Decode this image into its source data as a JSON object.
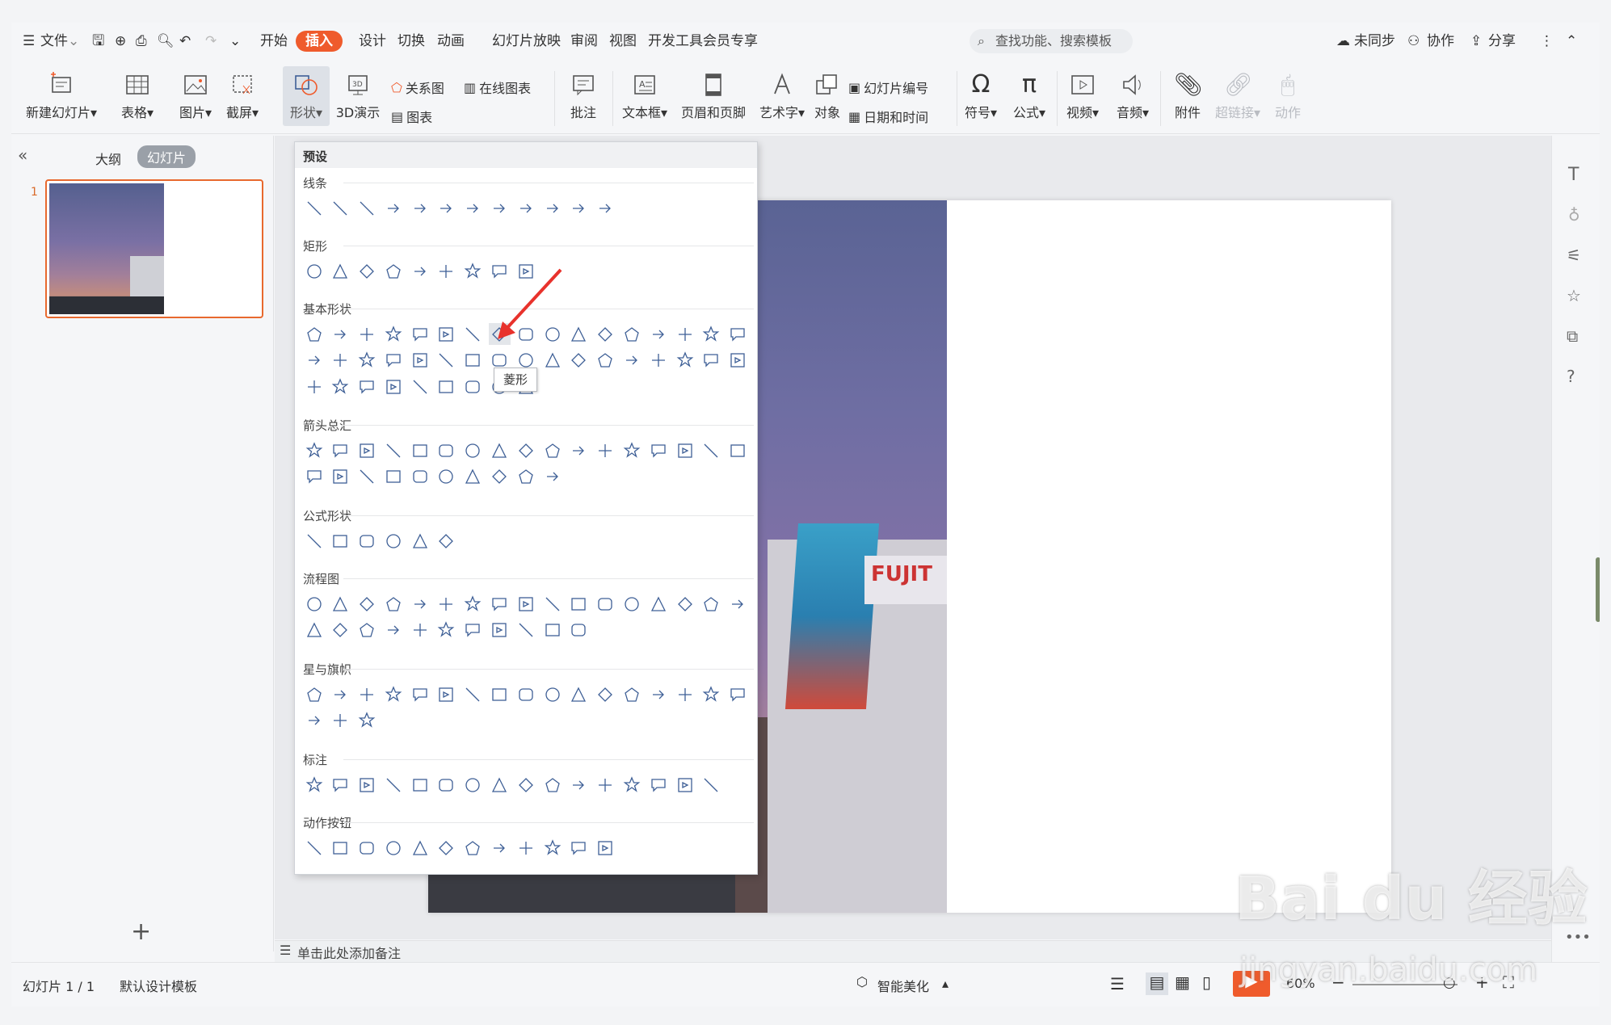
{
  "menubar": {
    "file": "文件",
    "tabs": [
      "开始",
      "插入",
      "设计",
      "切换",
      "动画",
      "幻灯片放映",
      "审阅",
      "视图",
      "开发工具",
      "会员专享"
    ],
    "search_placeholder": "查找功能、搜索模板",
    "sync": "未同步",
    "collab": "协作",
    "share": "分享"
  },
  "ribbon": {
    "new_slide": "新建幻灯片",
    "table": "表格",
    "picture": "图片",
    "screenshot": "截屏",
    "shapes": "形状",
    "smartart": "关系图",
    "online_chart": "在线图表",
    "demo3d": "3D演示",
    "chart": "图表",
    "comment": "批注",
    "textbox": "文本框",
    "header_footer": "页眉和页脚",
    "wordart": "艺术字",
    "object": "对象",
    "slide_number": "幻灯片编号",
    "datetime": "日期和时间",
    "symbol": "符号",
    "formula": "公式",
    "video": "视频",
    "audio": "音频",
    "attachment": "附件",
    "hyperlink": "超链接",
    "action": "动作"
  },
  "leftpanel": {
    "outline_tab": "大纲",
    "slides_tab": "幻灯片",
    "slide_index": "1"
  },
  "dropdown": {
    "header": "预设",
    "sections": [
      "线条",
      "矩形",
      "基本形状",
      "箭头总汇",
      "公式形状",
      "流程图",
      "星与旗帜",
      "标注",
      "动作按钮"
    ],
    "tooltip": "菱形"
  },
  "notes": {
    "placeholder": "单击此处添加备注"
  },
  "status": {
    "slide_counter": "幻灯片 1 / 1",
    "template": "默认设计模板",
    "beautify": "智能美化",
    "zoom": "60%"
  },
  "watermark": {
    "brand": "Bai du 经验",
    "url": "jingyan.baidu.com"
  },
  "colors": {
    "accent": "#ef5b2c",
    "shape_stroke": "#3e5f96",
    "selected_border": "#e8692e"
  }
}
